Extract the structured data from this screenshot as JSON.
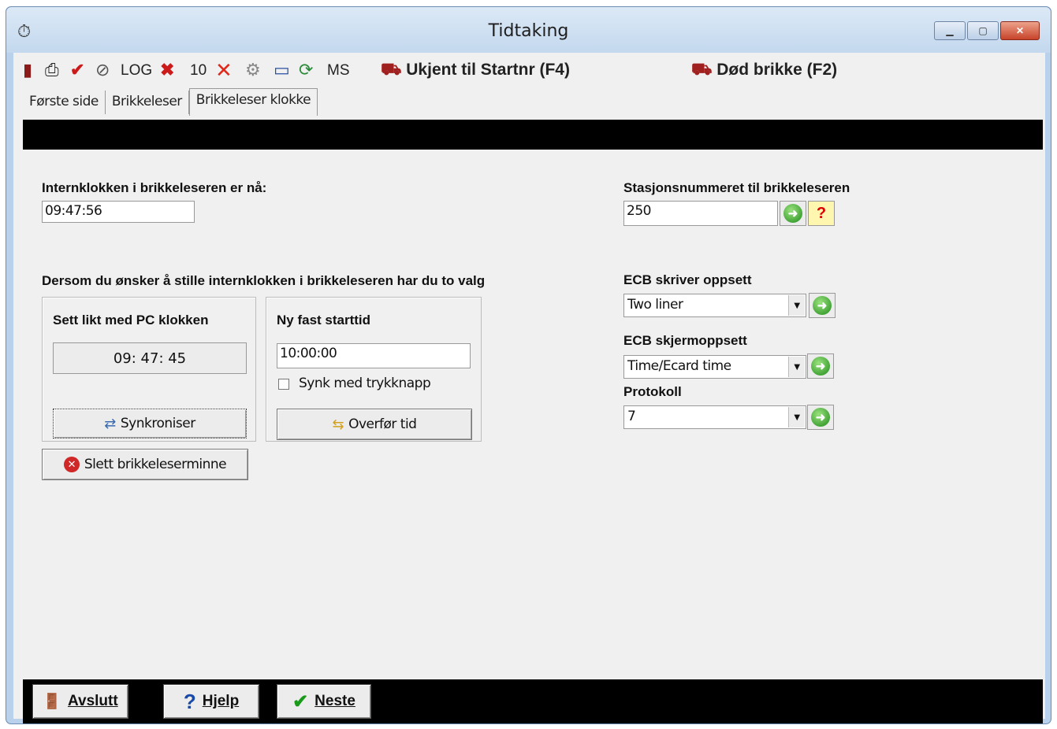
{
  "window": {
    "title": "Tidtaking"
  },
  "toolbar": {
    "log_label": "LOG",
    "ten_label": "10",
    "ms_label": "MS",
    "unknown_label": "Ukjent til Startnr (F4)",
    "dead_label": "Død brikke (F2)"
  },
  "tabs": [
    "Første side",
    "Brikkeleser",
    "Brikkeleser klokke"
  ],
  "clock": {
    "label": "Internklokken i brikkeleseren er nå:",
    "value": "09:47:56"
  },
  "choice": {
    "heading": "Dersom du ønsker å stille internklokken i brikkeleseren har du to valg"
  },
  "pc_panel": {
    "title": "Sett likt med PC klokken",
    "time": "09: 47: 45",
    "sync_button": "Synkroniser"
  },
  "fixed_panel": {
    "title": "Ny fast starttid",
    "value": "10:00:00",
    "checkbox_label": "Synk med trykknapp",
    "transfer_button": "Overfør tid"
  },
  "delete_button": "Slett brikkeleserminne",
  "station": {
    "label": "Stasjonsnummeret til brikkeleseren",
    "value": "250"
  },
  "ecb_printer": {
    "label": "ECB skriver oppsett",
    "value": "Two liner"
  },
  "ecb_screen": {
    "label": "ECB skjermoppsett",
    "value": "Time/Ecard time"
  },
  "protocol": {
    "label": "Protokoll",
    "value": "7"
  },
  "bottom": {
    "exit": "Avslutt",
    "help": "Hjelp",
    "next": "Neste"
  },
  "colors": {
    "go_green": "#1f8b1a",
    "close_red": "#c7432a",
    "bar_black": "#000000"
  }
}
